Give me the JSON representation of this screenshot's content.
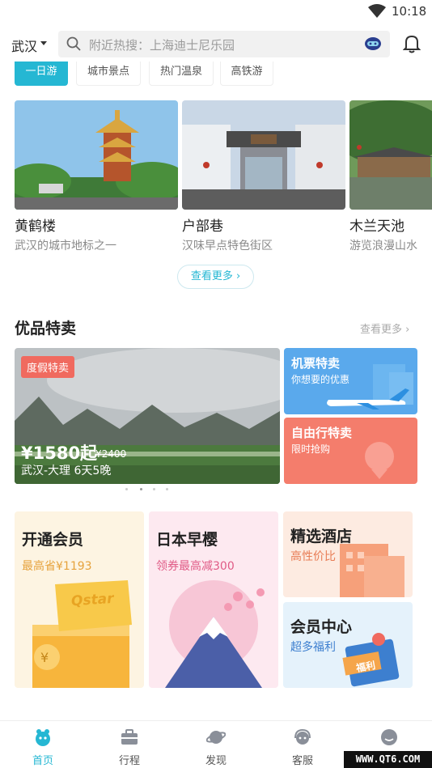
{
  "status": {
    "time": "10:18"
  },
  "header": {
    "city": "武汉",
    "search_placeholder": "附近热搜：上海迪士尼乐园"
  },
  "categories": [
    "一日游",
    "城市景点",
    "热门温泉",
    "高铁游"
  ],
  "spots": [
    {
      "name": "黄鹤楼",
      "desc": "武汉的城市地标之一"
    },
    {
      "name": "户部巷",
      "desc": "汉味早点特色街区"
    },
    {
      "name": "木兰天池",
      "desc": "游览浪漫山水"
    }
  ],
  "spots_more": "查看更多 ›",
  "deals": {
    "title": "优品特卖",
    "more": "查看更多 ›",
    "main": {
      "tag": "度假特卖",
      "price": "¥1580起",
      "orig_price": "¥2400",
      "route": "武汉-大理 6天5晚"
    },
    "flight": {
      "title": "机票特卖",
      "subtitle": "你想要的优惠"
    },
    "free": {
      "title": "自由行特卖",
      "subtitle": "限时抢购"
    }
  },
  "promos": [
    {
      "title": "开通会员",
      "subtitle": "最高省¥1193",
      "badge": "Qstar"
    },
    {
      "title": "日本早樱",
      "subtitle": "领券最高减300"
    },
    {
      "title": "精选酒店",
      "subtitle": "高性价比"
    },
    {
      "title": "会员中心",
      "subtitle": "超多福利",
      "badge": "福利"
    }
  ],
  "tabs": [
    {
      "label": "首页",
      "active": true
    },
    {
      "label": "行程"
    },
    {
      "label": "发现"
    },
    {
      "label": "客服"
    },
    {
      "label": "我的"
    }
  ],
  "watermark": "WWW.QT6.COM",
  "colors": {
    "accent": "#25b7d3",
    "deal_tag": "#f06a5f",
    "flight": "#5aa9ec",
    "free": "#f47d6c"
  }
}
